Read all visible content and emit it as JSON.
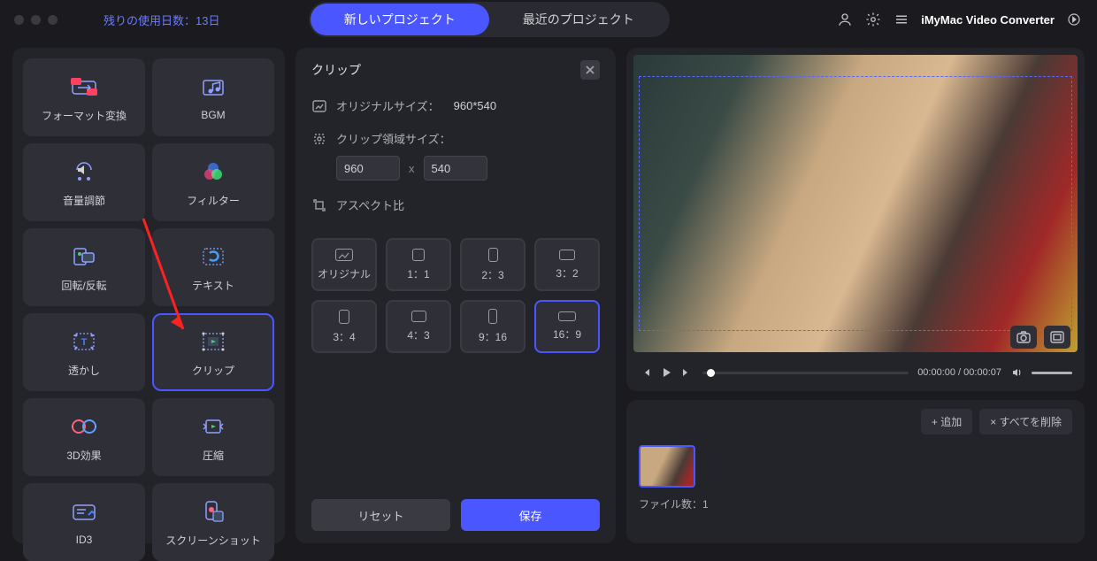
{
  "topbar": {
    "trial_label": "残りの使用日数：13日",
    "tab_new": "新しいプロジェクト",
    "tab_recent": "最近のプロジェクト",
    "app_name": "iMyMac Video Converter"
  },
  "sidebar": {
    "tiles": [
      {
        "id": "format",
        "label": "フォーマット変換"
      },
      {
        "id": "bgm",
        "label": "BGM"
      },
      {
        "id": "volume",
        "label": "音量調節"
      },
      {
        "id": "filter",
        "label": "フィルター"
      },
      {
        "id": "rotate",
        "label": "回転/反転"
      },
      {
        "id": "text",
        "label": "テキスト"
      },
      {
        "id": "watermark",
        "label": "透かし"
      },
      {
        "id": "clip",
        "label": "クリップ"
      },
      {
        "id": "3d",
        "label": "3D効果"
      },
      {
        "id": "compress",
        "label": "圧縮"
      },
      {
        "id": "id3",
        "label": "ID3"
      },
      {
        "id": "screenshot",
        "label": "スクリーンショット"
      }
    ]
  },
  "clip_panel": {
    "title": "クリップ",
    "original_size_label": "オリジナルサイズ：",
    "original_size_value": "960*540",
    "clip_size_label": "クリップ領域サイズ：",
    "width_value": "960",
    "height_value": "540",
    "x_sep": "x",
    "aspect_label": "アスペクト比",
    "aspects": [
      {
        "id": "original",
        "label": "オリジナル"
      },
      {
        "id": "1_1",
        "label": "1：1"
      },
      {
        "id": "2_3",
        "label": "2：3"
      },
      {
        "id": "3_2",
        "label": "3：2"
      },
      {
        "id": "3_4",
        "label": "3：4"
      },
      {
        "id": "4_3",
        "label": "4：3"
      },
      {
        "id": "9_16",
        "label": "9：16"
      },
      {
        "id": "16_9",
        "label": "16：9"
      }
    ],
    "reset": "リセット",
    "save": "保存"
  },
  "preview": {
    "time": "00:00:00 / 00:00:07"
  },
  "files": {
    "add": "+ 追加",
    "delete_all": "× すべてを削除",
    "count_label": "ファイル数：1"
  }
}
